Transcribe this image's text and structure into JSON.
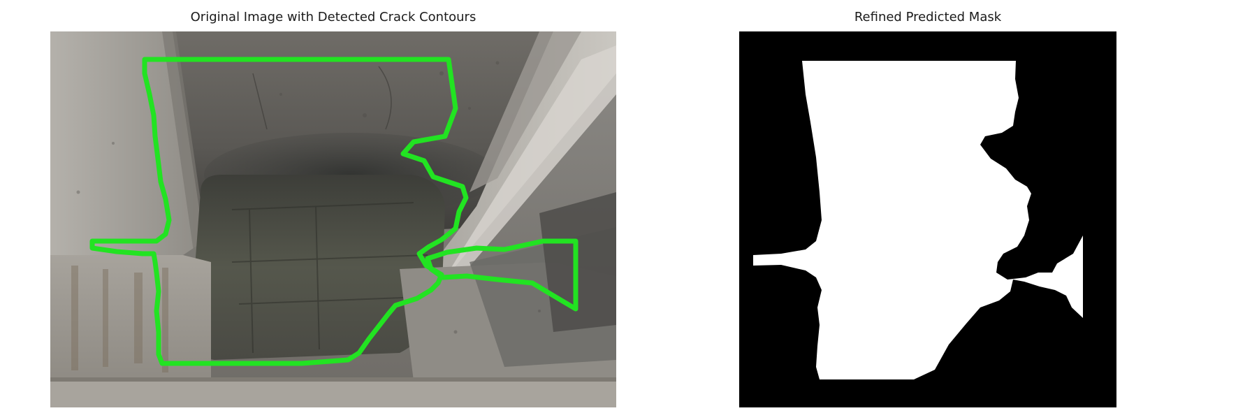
{
  "figure": {
    "left_panel": {
      "title": "Original Image with Detected Crack Contours",
      "contour_color": "#22e322"
    },
    "right_panel": {
      "title": "Refined Predicted Mask",
      "mask_foreground": "#ffffff",
      "mask_background": "#000000"
    }
  }
}
